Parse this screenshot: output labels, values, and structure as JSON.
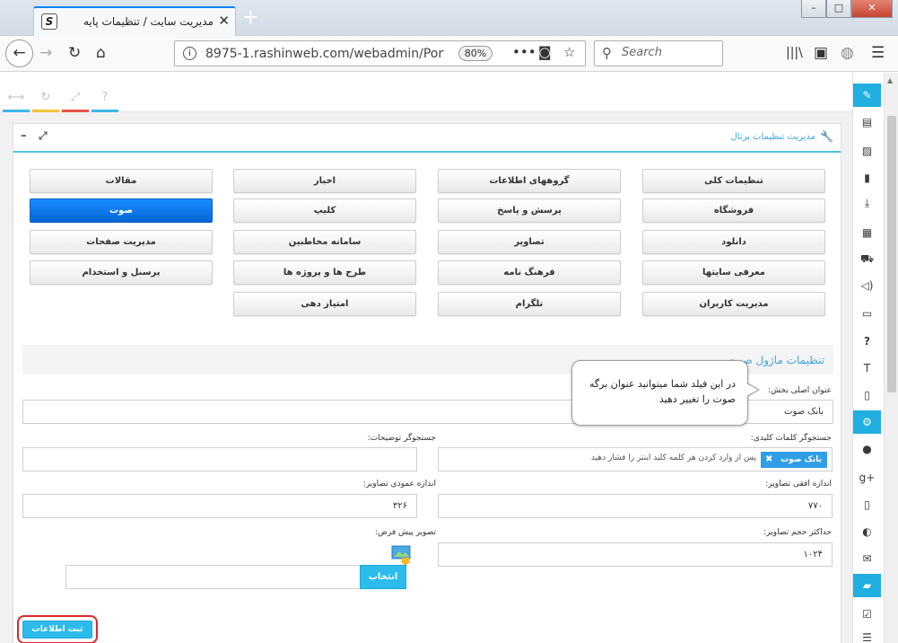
{
  "browser": {
    "tab_title": "مدیریت سایت / تنظیمات پایه",
    "url": "8975-1.rashinweb.com/webadmin/Porta",
    "zoom": "80%",
    "search_placeholder": "Search"
  },
  "panel": {
    "title": "مدیریت تنظیمات پرتال"
  },
  "modules": [
    {
      "label": "تنظیمات کلی"
    },
    {
      "label": "گروههای اطلاعات"
    },
    {
      "label": "اخبار"
    },
    {
      "label": "مقالات"
    },
    {
      "label": "فروشگاه"
    },
    {
      "label": "پرسش و پاسخ"
    },
    {
      "label": "کلیپ"
    },
    {
      "label": "صوت"
    },
    {
      "label": "دانلود"
    },
    {
      "label": "تصاویر"
    },
    {
      "label": "سامانه مخاطبین"
    },
    {
      "label": "مدیریت صفحات"
    },
    {
      "label": "معرفی سایتها"
    },
    {
      "label": "فرهنگ نامه"
    },
    {
      "label": "طرح ها و پروژه ها"
    },
    {
      "label": "پرسنل و استخدام"
    },
    {
      "label": "مدیریت کاربران"
    },
    {
      "label": "تلگرام"
    },
    {
      "label": "امتیاز دهی"
    }
  ],
  "active_module": "صوت",
  "section": {
    "title": "تنظیمات ماژول صوت"
  },
  "form": {
    "main_title_label": "عنوان اصلی بخش:",
    "main_title_value": "بانک صوت",
    "keywords_label": "جستجوگر کلمات کلیدی:",
    "keywords_tag": "بانک صوت",
    "keywords_placeholder": "پس از وارد کردن هر کلمه کلید اینتر را فشار دهید",
    "description_label": "جستجوگر توضیحات:",
    "description_value": "",
    "img_width_label": "اندازه افقی تصاویر:",
    "img_width_value": "۷۷۰",
    "img_height_label": "اندازه عمودی تصاویر:",
    "img_height_value": "۳۲۶",
    "img_max_size_label": "حداکثر حجم تصاویر:",
    "img_max_size_value": "۱۰۲۴",
    "default_image_label": "تصویر پیش فرض:",
    "choose_label": "انتخاب",
    "submit_label": "ثبت اطلاعات"
  },
  "tooltip": {
    "text": "در این فیلد شما میتوانید عنوان برگه صوت را تغییر دهید"
  },
  "colors": {
    "accent": "#21aee0",
    "active_module": "#0a74e8",
    "highlight_ring": "#e0262c"
  }
}
